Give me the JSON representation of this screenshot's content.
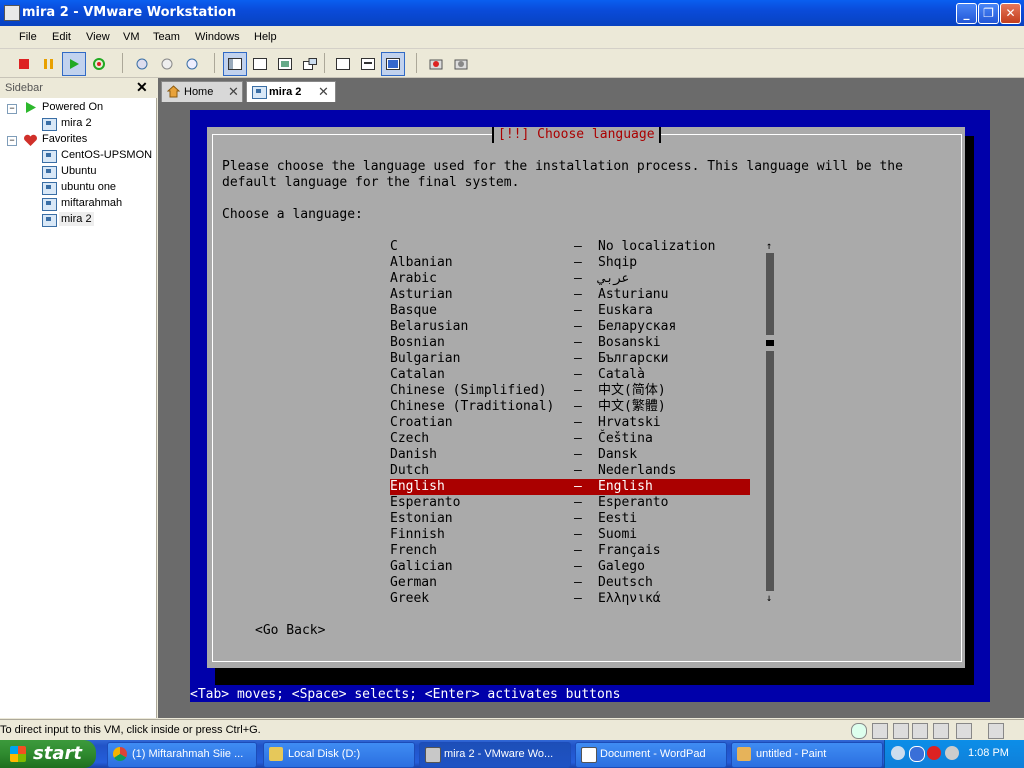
{
  "window": {
    "title": "mira 2 - VMware Workstation",
    "controls": {
      "minimize": "_",
      "maximize": "❐",
      "close": "✕"
    }
  },
  "menu": [
    "File",
    "Edit",
    "View",
    "VM",
    "Team",
    "Windows",
    "Help"
  ],
  "sidebar": {
    "title": "Sidebar",
    "close": "✕",
    "groups": [
      {
        "label": "Powered On",
        "items": [
          "mira 2"
        ]
      },
      {
        "label": "Favorites",
        "items": [
          "CentOS-UPSMON",
          "Ubuntu",
          "ubuntu one",
          "miftarahmah",
          "mira 2"
        ]
      }
    ],
    "expander": "⊟"
  },
  "tabs": [
    {
      "label": "Home",
      "close": "✕"
    },
    {
      "label": "mira 2",
      "close": "✕"
    }
  ],
  "installer": {
    "title": "[!!] Choose language",
    "intro_line1": "Please choose the language used for the installation process. This language will be the",
    "intro_line2": "default language for the final system.",
    "prompt": "Choose a language:",
    "dash": "–",
    "languages": [
      {
        "name": "C",
        "local": "No localization"
      },
      {
        "name": "Albanian",
        "local": "Shqip"
      },
      {
        "name": "Arabic",
        "local": "عربي"
      },
      {
        "name": "Asturian",
        "local": "Asturianu"
      },
      {
        "name": "Basque",
        "local": "Euskara"
      },
      {
        "name": "Belarusian",
        "local": "Беларуская"
      },
      {
        "name": "Bosnian",
        "local": "Bosanski"
      },
      {
        "name": "Bulgarian",
        "local": "Български"
      },
      {
        "name": "Catalan",
        "local": "Català"
      },
      {
        "name": "Chinese (Simplified)",
        "local": "中文(简体)"
      },
      {
        "name": "Chinese (Traditional)",
        "local": "中文(繁體)"
      },
      {
        "name": "Croatian",
        "local": "Hrvatski"
      },
      {
        "name": "Czech",
        "local": "Čeština"
      },
      {
        "name": "Danish",
        "local": "Dansk"
      },
      {
        "name": "Dutch",
        "local": "Nederlands"
      },
      {
        "name": "English",
        "local": "English"
      },
      {
        "name": "Esperanto",
        "local": "Esperanto"
      },
      {
        "name": "Estonian",
        "local": "Eesti"
      },
      {
        "name": "Finnish",
        "local": "Suomi"
      },
      {
        "name": "French",
        "local": "Français"
      },
      {
        "name": "Galician",
        "local": "Galego"
      },
      {
        "name": "German",
        "local": "Deutsch"
      },
      {
        "name": "Greek",
        "local": "Ελληνικά"
      }
    ],
    "selected_index": 15,
    "scroll_up": "↑",
    "scroll_down": "↓",
    "go_back": "<Go Back>",
    "help_line": "<Tab> moves; <Space> selects; <Enter> activates buttons"
  },
  "statusbar": {
    "message": "To direct input to this VM, click inside or press Ctrl+G."
  },
  "taskbar": {
    "start": "start",
    "tasks": [
      {
        "label": "(1) Miftarahmah Siie ...",
        "color": "#d9a53a"
      },
      {
        "label": "Local Disk (D:)",
        "color": "#e6c85a"
      },
      {
        "label": "mira 2 - VMware Wo...",
        "color": "#c8c8c8"
      },
      {
        "label": "Document - WordPad",
        "color": "#ffffff"
      },
      {
        "label": "untitled - Paint",
        "color": "#e6b35a"
      }
    ],
    "clock": "1:08 PM"
  },
  "colors": {
    "installer_bg": "#0000aa",
    "dialog": "#aaaaaa",
    "highlight": "#aa0000",
    "title_red": "#aa0000"
  }
}
